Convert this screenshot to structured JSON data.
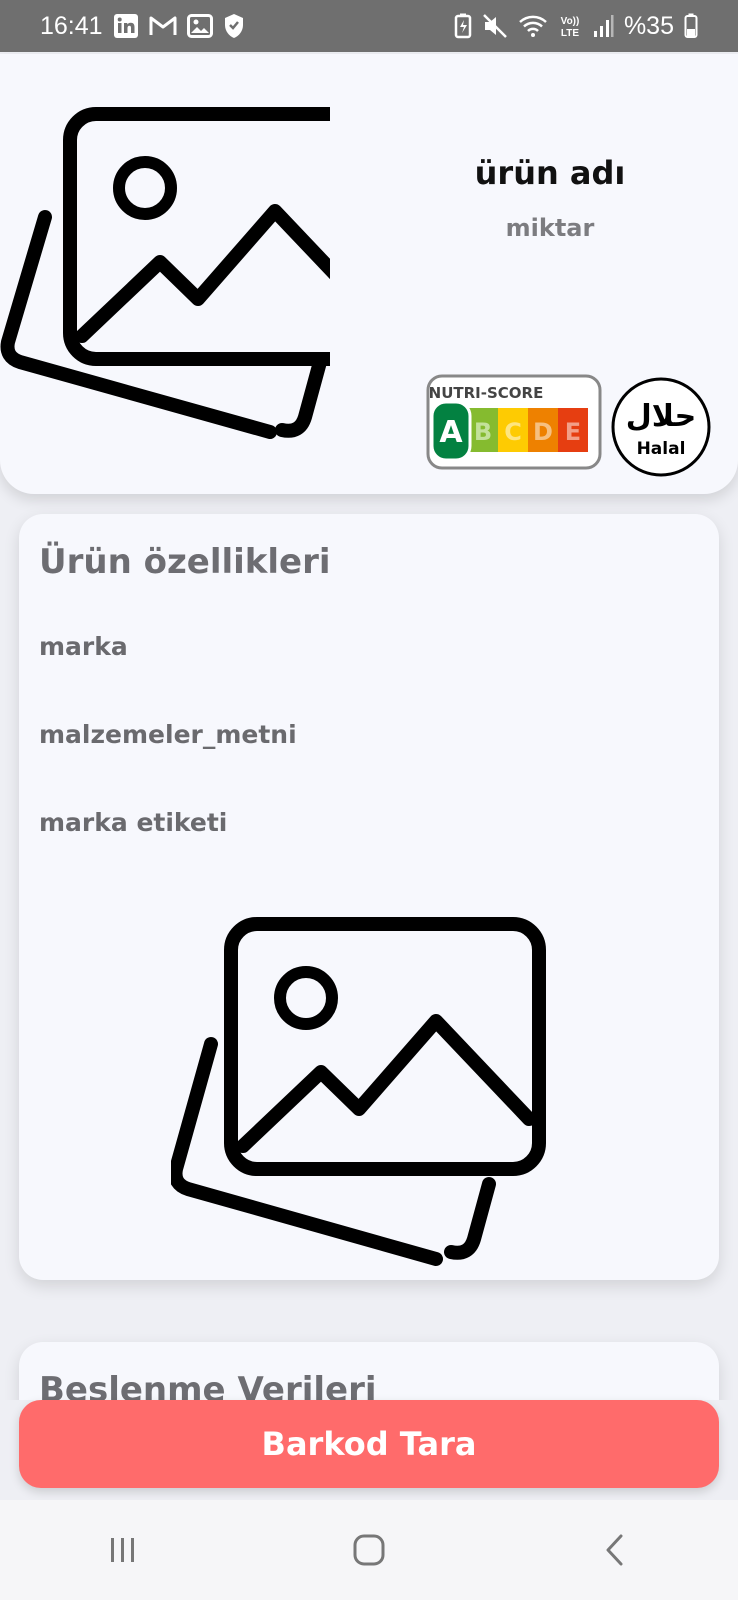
{
  "status_bar": {
    "time": "16:41",
    "battery_text": "%35",
    "left_icons": [
      "linkedin-icon",
      "gmail-icon",
      "gallery-icon",
      "shield-icon"
    ],
    "right_icons": [
      "battery-saver-icon",
      "mute-icon",
      "wifi-icon",
      "volte-icon",
      "signal-icon",
      "battery-icon"
    ]
  },
  "product": {
    "name": "ürün adı",
    "quantity": "miktar",
    "image_icon": "image-placeholder-icon",
    "nutri_score": {
      "label": "NUTRI-SCORE",
      "grades": [
        "A",
        "B",
        "C",
        "D",
        "E"
      ],
      "selected": "A",
      "colors": [
        "#038141",
        "#85bb2f",
        "#fecb02",
        "#ee8100",
        "#e63e11"
      ]
    },
    "halal": {
      "label": "Halal",
      "arabic": "حلال"
    }
  },
  "features": {
    "title": "Ürün özellikleri",
    "rows": [
      "marka",
      "malzemeler_metni",
      "marka etiketi"
    ],
    "image_icon": "image-placeholder-icon"
  },
  "nutrition": {
    "title": "Beslenme Verileri"
  },
  "scan_button": {
    "label": "Barkod Tara",
    "color": "#ff6b6b"
  },
  "navigation": {
    "items": [
      "recent-apps-icon",
      "home-icon",
      "back-icon"
    ]
  }
}
